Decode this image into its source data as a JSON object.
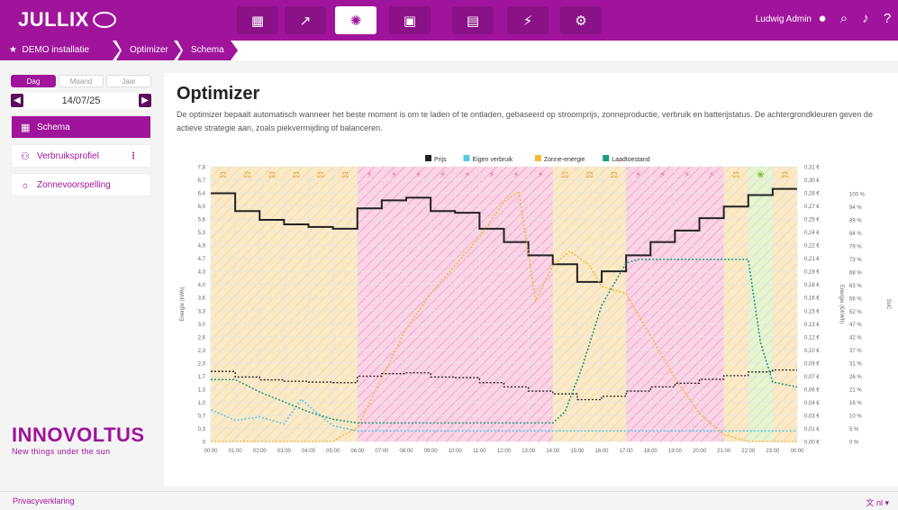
{
  "app": {
    "logo": "JULLIX"
  },
  "nav": [
    {
      "name": "nav-dashboard",
      "icon": "▦",
      "active": false
    },
    {
      "name": "nav-charts",
      "icon": "↗",
      "active": false
    },
    {
      "name": "nav-optimizer",
      "icon": "⚙",
      "active": true
    },
    {
      "name": "nav-battery",
      "icon": "▣",
      "active": false
    },
    {
      "name": "nav-meter",
      "icon": "▤",
      "active": false
    },
    {
      "name": "nav-plug",
      "icon": "⏚",
      "active": false
    },
    {
      "name": "nav-settings",
      "icon": "✲",
      "active": false
    }
  ],
  "user": {
    "name": "Ludwig Admin"
  },
  "breadcrumb": [
    "DEMO installatie",
    "Optimizer",
    "Schema"
  ],
  "period": {
    "tabs": [
      "Dag",
      "Maand",
      "Jaar"
    ],
    "active": "Dag",
    "date": "14/07/25"
  },
  "sidebar": {
    "items": [
      "Schema",
      "Verbruiksprofiel",
      "Zonnevoorspelling"
    ]
  },
  "brand": {
    "name": "INNOVOLTUS",
    "tagline": "New things under the sun"
  },
  "page": {
    "title": "Optimizer",
    "description": "De optimizer bepaalt automatisch wanneer het beste moment is om te laden of te ontladen, gebaseerd op stroomprijs, zonneproductie, verbruik en batterijstatus. De achtergrondkleuren geven de actieve strategie aan, zoals piekvermijding of balanceren."
  },
  "footer": {
    "privacy": "Privacyverklaring",
    "language": "nl"
  },
  "chart_data": {
    "type": "line",
    "legend": [
      "Prijs",
      "Eigen verbruik",
      "Zonne-energie",
      "Laadtoestand"
    ],
    "colors": {
      "price": "#222222",
      "own": "#5bc8ea",
      "solar": "#f5b83a",
      "soc": "#1a9a80",
      "bg_balance": "#fbeac8",
      "bg_peak": "#fbd3e6",
      "bg_green": "#e6f4d2",
      "brand": "#a0149c"
    },
    "x_ticks": [
      "00:00",
      "01:00",
      "02:00",
      "03:00",
      "04:00",
      "05:00",
      "06:00",
      "07:00",
      "08:00",
      "09:00",
      "10:00",
      "11:00",
      "12:00",
      "13:00",
      "14:00",
      "15:00",
      "16:00",
      "17:00",
      "18:00",
      "19:00",
      "20:00",
      "21:00",
      "22:00",
      "23:00",
      "00:00"
    ],
    "y_left_ticks": [
      "7,8",
      "6,7",
      "6,4",
      "6,0",
      "5,6",
      "5,3",
      "4,9",
      "4,7",
      "4,3",
      "4,0",
      "3,6",
      "3,3",
      "3,0",
      "2,6",
      "2,3",
      "2,0",
      "1,7",
      "1,3",
      "1,0",
      "0,7",
      "0,3",
      "0"
    ],
    "y_mid_ticks": [
      "0,31 €",
      "0,30 €",
      "0,28 €",
      "0,27 €",
      "0,25 €",
      "0,24 €",
      "0,22 €",
      "0,21 €",
      "0,19 €",
      "0,18 €",
      "0,16 €",
      "0,15 €",
      "0,13 €",
      "0,12 €",
      "0,10 €",
      "0,09 €",
      "0,07 €",
      "0,06 €",
      "0,04 €",
      "0,03 €",
      "0,01 €",
      "0,00 €"
    ],
    "y_right_ticks": [
      "100 %",
      "94 %",
      "89 %",
      "84 %",
      "79 %",
      "73 %",
      "68 %",
      "63 %",
      "58 %",
      "52 %",
      "47 %",
      "42 %",
      "37 %",
      "31 %",
      "26 %",
      "21 %",
      "16 %",
      "10 %",
      "5 %",
      "0 %"
    ],
    "ylabel_left": "Energie (kWh)",
    "ylabel_mid": "Energie (€/kWh)",
    "ylabel_right": "SoC",
    "strategy": [
      "balance",
      "balance",
      "balance",
      "balance",
      "balance",
      "balance",
      "peak",
      "peak",
      "peak",
      "peak",
      "peak",
      "peak",
      "peak",
      "peak",
      "balance",
      "balance",
      "balance",
      "peak",
      "peak",
      "peak",
      "peak",
      "balance",
      "green",
      "balance"
    ],
    "price": [
      0.28,
      0.26,
      0.25,
      0.245,
      0.242,
      0.24,
      0.263,
      0.272,
      0.275,
      0.26,
      0.258,
      0.24,
      0.225,
      0.21,
      0.2,
      0.18,
      0.192,
      0.21,
      0.225,
      0.238,
      0.252,
      0.265,
      0.278,
      0.285
    ],
    "own_consumption_points": [
      [
        0,
        0.9
      ],
      [
        1,
        0.6
      ],
      [
        2,
        0.7
      ],
      [
        3,
        0.5
      ],
      [
        3.7,
        1.2
      ],
      [
        4.2,
        0.9
      ],
      [
        5,
        0.45
      ],
      [
        6,
        0.3
      ],
      [
        8,
        0.3
      ],
      [
        12,
        0.3
      ],
      [
        16,
        0.3
      ],
      [
        20,
        0.3
      ],
      [
        24,
        0.3
      ]
    ],
    "solar_points": [
      [
        0,
        0
      ],
      [
        5,
        0
      ],
      [
        6,
        0.4
      ],
      [
        7,
        1.8
      ],
      [
        8,
        3.2
      ],
      [
        9,
        4.2
      ],
      [
        10,
        5.0
      ],
      [
        11,
        5.8
      ],
      [
        12,
        6.8
      ],
      [
        12.6,
        7.1
      ],
      [
        13.3,
        4.0
      ],
      [
        14,
        5.0
      ],
      [
        14.7,
        5.4
      ],
      [
        15.5,
        5.0
      ],
      [
        16,
        4.4
      ],
      [
        17,
        4.2
      ],
      [
        18,
        3.0
      ],
      [
        19,
        1.8
      ],
      [
        20,
        0.8
      ],
      [
        21,
        0.2
      ],
      [
        22,
        0
      ],
      [
        24,
        0
      ]
    ],
    "soc_points": [
      [
        0,
        25
      ],
      [
        1,
        25
      ],
      [
        2,
        20
      ],
      [
        3,
        16
      ],
      [
        4,
        12
      ],
      [
        5,
        9
      ],
      [
        6,
        7.5
      ],
      [
        8,
        7.5
      ],
      [
        12,
        7.5
      ],
      [
        14,
        7.5
      ],
      [
        14.5,
        12
      ],
      [
        15.2,
        30
      ],
      [
        16,
        55
      ],
      [
        17,
        72
      ],
      [
        17.5,
        73.5
      ],
      [
        21,
        73.5
      ],
      [
        22,
        73.5
      ],
      [
        22.5,
        40
      ],
      [
        23,
        24
      ],
      [
        24,
        22
      ]
    ],
    "soc_ylim": [
      0,
      100
    ],
    "kwh_ylim": [
      0,
      7.8
    ],
    "price_ylim": [
      0,
      0.31
    ]
  }
}
